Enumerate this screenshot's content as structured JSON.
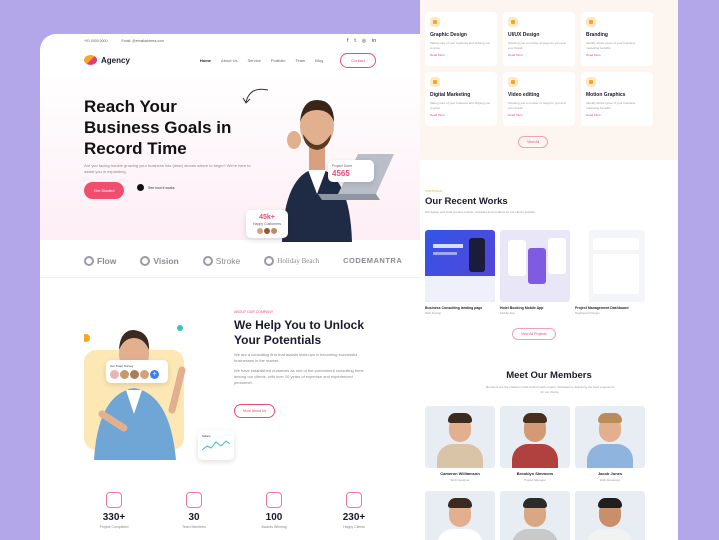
{
  "left_page": {
    "topbar": {
      "phone": "+91 0000 0000",
      "email": "Email: @emailaddress.com",
      "social": [
        "f",
        "t",
        "◎",
        "in"
      ]
    },
    "logo": "Agency",
    "nav": [
      "Home",
      "About Us",
      "Service",
      "Portfolio",
      "Team",
      "Blog"
    ],
    "contact_btn": "Contact",
    "hero": {
      "title": "Reach Your Business Goals in Record Time",
      "subtitle": "Are you facing trouble growing your business into (dear) stones where to begin? We're here to assist you in expanding.",
      "cta": "Get Started",
      "play_label": "See how it works",
      "project_done_label": "Project Done",
      "project_done": "4565",
      "customers": "45k+",
      "customers_label": "Happy Customers"
    },
    "brands": [
      "Flow",
      "Vision",
      "Stroke",
      "Holiday Beach",
      "CODEMANTRA"
    ],
    "about": {
      "tag": "ABOUT OUR COMPANY",
      "title": "We Help You to Unlock Your Potentials",
      "text1": "We are a consulting firm that assists start-ups in becoming successful businesses in the market.",
      "text2": "We have established ourselves as one of the preeminent consulting firms among our clients, with over 10 years of expertise and experienced personnel.",
      "btn": "More About Us",
      "team_label": "Our Team Survey",
      "chart_label": "Salary"
    },
    "stats": [
      {
        "num": "330+",
        "label": "Project Completed"
      },
      {
        "num": "30",
        "label": "Team Members"
      },
      {
        "num": "100",
        "label": "Awards Winning"
      },
      {
        "num": "230+",
        "label": "Happy Clients"
      }
    ]
  },
  "right_page": {
    "services": [
      {
        "title": "Graphic Design",
        "desc": "Taking care of your business and helping you to grow.",
        "more": "Read More"
      },
      {
        "title": "UI/UX Design",
        "desc": "Showing you a number of ways for you and your brand.",
        "more": "Read More"
      },
      {
        "title": "Branding",
        "desc": "Identify all the types of your business marketing benefits.",
        "more": "Read More"
      },
      {
        "title": "Digital Marketing",
        "desc": "Taking care of your business and helping you to grow.",
        "more": "Read More"
      },
      {
        "title": "Video editing",
        "desc": "Showing you a number of ways for you and your brand.",
        "more": "Read More"
      },
      {
        "title": "Motion Graphics",
        "desc": "Identify all the types of your business marketing benefits.",
        "more": "Read More"
      }
    ],
    "services_btn": "View All",
    "works_tag": "PORTFOLIO",
    "works_title": "Our Recent Works",
    "works_sub": "We design and build creative brands, websites and products for our clients globally.",
    "works": [
      {
        "title": "Business Consulting landing page",
        "cat": "Web Design"
      },
      {
        "title": "Hotel Booking Mobile App",
        "cat": "Mobile App"
      },
      {
        "title": "Project Management Dashboard",
        "cat": "Dashboard Design"
      }
    ],
    "works_btn": "View All Projects",
    "members_title": "Meet Our Members",
    "members_sub": "Members are the creative minds behind each project, dedicated to delivering the best experience for our clients.",
    "members": [
      {
        "name": "Cameron Williamson",
        "role": "Web Designer"
      },
      {
        "name": "Brooklyn Simmons",
        "role": "Project Manager"
      },
      {
        "name": "Jacob Jones",
        "role": "Web Developer"
      },
      {
        "name": "",
        "role": ""
      },
      {
        "name": "",
        "role": ""
      },
      {
        "name": "",
        "role": ""
      }
    ]
  }
}
